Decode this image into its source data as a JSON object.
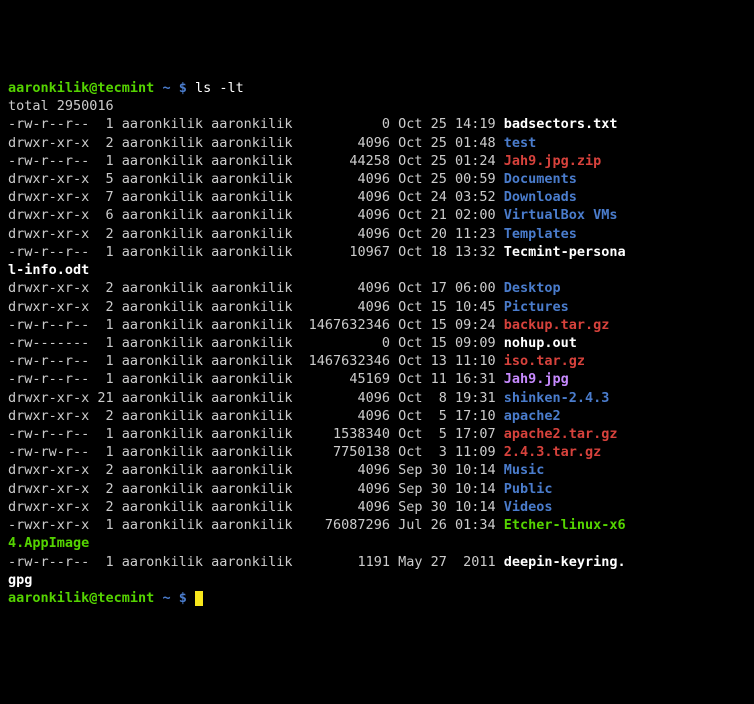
{
  "prompt": {
    "user": "aaronkilik@tecmint",
    "sep": " ~ $ ",
    "command": "ls -lt"
  },
  "total_line": "total 2950016",
  "rows": [
    {
      "perm": "-rw-r--r--",
      "links": "1",
      "user": "aaronkilik",
      "group": "aaronkilik",
      "size": "0",
      "mon": "Oct",
      "day": "25",
      "time": "14:19",
      "name": "badsectors.txt",
      "cls": "white"
    },
    {
      "perm": "drwxr-xr-x",
      "links": "2",
      "user": "aaronkilik",
      "group": "aaronkilik",
      "size": "4096",
      "mon": "Oct",
      "day": "25",
      "time": "01:48",
      "name": "test",
      "cls": "blue"
    },
    {
      "perm": "-rw-r--r--",
      "links": "1",
      "user": "aaronkilik",
      "group": "aaronkilik",
      "size": "44258",
      "mon": "Oct",
      "day": "25",
      "time": "01:24",
      "name": "Jah9.jpg.zip",
      "cls": "red"
    },
    {
      "perm": "drwxr-xr-x",
      "links": "5",
      "user": "aaronkilik",
      "group": "aaronkilik",
      "size": "4096",
      "mon": "Oct",
      "day": "25",
      "time": "00:59",
      "name": "Documents",
      "cls": "blue"
    },
    {
      "perm": "drwxr-xr-x",
      "links": "7",
      "user": "aaronkilik",
      "group": "aaronkilik",
      "size": "4096",
      "mon": "Oct",
      "day": "24",
      "time": "03:52",
      "name": "Downloads",
      "cls": "blue"
    },
    {
      "perm": "drwxr-xr-x",
      "links": "6",
      "user": "aaronkilik",
      "group": "aaronkilik",
      "size": "4096",
      "mon": "Oct",
      "day": "21",
      "time": "02:00",
      "name": "VirtualBox VMs",
      "cls": "blue"
    },
    {
      "perm": "drwxr-xr-x",
      "links": "2",
      "user": "aaronkilik",
      "group": "aaronkilik",
      "size": "4096",
      "mon": "Oct",
      "day": "20",
      "time": "11:23",
      "name": "Templates",
      "cls": "blue"
    },
    {
      "perm": "-rw-r--r--",
      "links": "1",
      "user": "aaronkilik",
      "group": "aaronkilik",
      "size": "10967",
      "mon": "Oct",
      "day": "18",
      "time": "13:32",
      "name": "Tecmint-persona",
      "cls": "white",
      "wrap": "l-info.odt",
      "wrapcls": "white"
    },
    {
      "perm": "drwxr-xr-x",
      "links": "2",
      "user": "aaronkilik",
      "group": "aaronkilik",
      "size": "4096",
      "mon": "Oct",
      "day": "17",
      "time": "06:00",
      "name": "Desktop",
      "cls": "blue"
    },
    {
      "perm": "drwxr-xr-x",
      "links": "2",
      "user": "aaronkilik",
      "group": "aaronkilik",
      "size": "4096",
      "mon": "Oct",
      "day": "15",
      "time": "10:45",
      "name": "Pictures",
      "cls": "blue"
    },
    {
      "perm": "-rw-r--r--",
      "links": "1",
      "user": "aaronkilik",
      "group": "aaronkilik",
      "size": "1467632346",
      "mon": "Oct",
      "day": "15",
      "time": "09:24",
      "name": "backup.tar.gz",
      "cls": "red"
    },
    {
      "perm": "-rw-------",
      "links": "1",
      "user": "aaronkilik",
      "group": "aaronkilik",
      "size": "0",
      "mon": "Oct",
      "day": "15",
      "time": "09:09",
      "name": "nohup.out",
      "cls": "white"
    },
    {
      "perm": "-rw-r--r--",
      "links": "1",
      "user": "aaronkilik",
      "group": "aaronkilik",
      "size": "1467632346",
      "mon": "Oct",
      "day": "13",
      "time": "11:10",
      "name": "iso.tar.gz",
      "cls": "red"
    },
    {
      "perm": "-rw-r--r--",
      "links": "1",
      "user": "aaronkilik",
      "group": "aaronkilik",
      "size": "45169",
      "mon": "Oct",
      "day": "11",
      "time": "16:31",
      "name": "Jah9.jpg",
      "cls": "magenta"
    },
    {
      "perm": "drwxr-xr-x",
      "links": "21",
      "user": "aaronkilik",
      "group": "aaronkilik",
      "size": "4096",
      "mon": "Oct",
      "day": "8",
      "time": "19:31",
      "name": "shinken-2.4.3",
      "cls": "blue"
    },
    {
      "perm": "drwxr-xr-x",
      "links": "2",
      "user": "aaronkilik",
      "group": "aaronkilik",
      "size": "4096",
      "mon": "Oct",
      "day": "5",
      "time": "17:10",
      "name": "apache2",
      "cls": "blue"
    },
    {
      "perm": "-rw-r--r--",
      "links": "1",
      "user": "aaronkilik",
      "group": "aaronkilik",
      "size": "1538340",
      "mon": "Oct",
      "day": "5",
      "time": "17:07",
      "name": "apache2.tar.gz",
      "cls": "red"
    },
    {
      "perm": "-rw-rw-r--",
      "links": "1",
      "user": "aaronkilik",
      "group": "aaronkilik",
      "size": "7750138",
      "mon": "Oct",
      "day": "3",
      "time": "11:09",
      "name": "2.4.3.tar.gz",
      "cls": "red"
    },
    {
      "perm": "drwxr-xr-x",
      "links": "2",
      "user": "aaronkilik",
      "group": "aaronkilik",
      "size": "4096",
      "mon": "Sep",
      "day": "30",
      "time": "10:14",
      "name": "Music",
      "cls": "blue"
    },
    {
      "perm": "drwxr-xr-x",
      "links": "2",
      "user": "aaronkilik",
      "group": "aaronkilik",
      "size": "4096",
      "mon": "Sep",
      "day": "30",
      "time": "10:14",
      "name": "Public",
      "cls": "blue"
    },
    {
      "perm": "drwxr-xr-x",
      "links": "2",
      "user": "aaronkilik",
      "group": "aaronkilik",
      "size": "4096",
      "mon": "Sep",
      "day": "30",
      "time": "10:14",
      "name": "Videos",
      "cls": "blue"
    },
    {
      "perm": "-rwxr-xr-x",
      "links": "1",
      "user": "aaronkilik",
      "group": "aaronkilik",
      "size": "76087296",
      "mon": "Jul",
      "day": "26",
      "time": "01:34",
      "name": "Etcher-linux-x6",
      "cls": "green",
      "wrap": "4.AppImage",
      "wrapcls": "green"
    },
    {
      "perm": "-rw-r--r--",
      "links": "1",
      "user": "aaronkilik",
      "group": "aaronkilik",
      "size": "1191",
      "mon": "May",
      "day": "27",
      "time": "2011",
      "name": "deepin-keyring.",
      "cls": "white",
      "wrap": "gpg",
      "wrapcls": "white"
    }
  ]
}
